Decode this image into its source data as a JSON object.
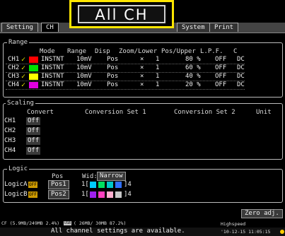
{
  "tabs": [
    "Setting",
    "CH",
    "System",
    "Print"
  ],
  "title": "All CH",
  "range": {
    "legend": "Range",
    "headers": [
      "Mode",
      "Range",
      "Disp",
      "Zoom/Lower",
      "Pos/Upper",
      "L.P.F.",
      "C"
    ],
    "rows": [
      {
        "ch": "CH1",
        "color": "#ff0000",
        "mode": "INSTNT",
        "range": "10mV",
        "disp": "Pos",
        "x": "×",
        "zoom": "1",
        "pos": "80 %",
        "lpf": "OFF",
        "c": "DC"
      },
      {
        "ch": "CH2",
        "color": "#00e000",
        "mode": "INSTNT",
        "range": "10mV",
        "disp": "Pos",
        "x": "×",
        "zoom": "1",
        "pos": "60 %",
        "lpf": "OFF",
        "c": "DC"
      },
      {
        "ch": "CH3",
        "color": "#ffff00",
        "mode": "INSTNT",
        "range": "10mV",
        "disp": "Pos",
        "x": "×",
        "zoom": "1",
        "pos": "40 %",
        "lpf": "OFF",
        "c": "DC"
      },
      {
        "ch": "CH4",
        "color": "#e000e0",
        "mode": "INSTNT",
        "range": "10mV",
        "disp": "Pos",
        "x": "×",
        "zoom": "1",
        "pos": "20 %",
        "lpf": "OFF",
        "c": "DC"
      }
    ]
  },
  "scaling": {
    "legend": "Scaling",
    "headers": [
      "Convert",
      "Conversion Set 1",
      "Conversion Set 2",
      "Unit"
    ],
    "rows": [
      {
        "ch": "CH1",
        "value": "Off"
      },
      {
        "ch": "CH2",
        "value": "Off"
      },
      {
        "ch": "CH3",
        "value": "Off"
      },
      {
        "ch": "CH4",
        "value": "Off"
      }
    ]
  },
  "logic": {
    "legend": "Logic",
    "pos_header": "Pos",
    "wid_label": "Wid:",
    "wid_value": "Narrow",
    "rows": [
      {
        "name": "LogicA",
        "tag": "OFF",
        "pos": "Pos1",
        "start": "1[",
        "end": "]4",
        "colors": [
          "#00ccff",
          "#00e060",
          "#00c8c8",
          "#3070ff"
        ]
      },
      {
        "name": "LogicB",
        "tag": "OFF",
        "pos": "Pos2",
        "start": "1[",
        "end": "]4",
        "colors": [
          "#a020f0",
          "#ff40c0",
          "#ffb0d0",
          "#c8c8c8"
        ]
      }
    ]
  },
  "zero_adj": "Zero adj.",
  "status": {
    "left": "CF (5.9MB/249MB 2.4%)",
    "usb_prefix": "USB",
    "mid": "( 26MB/ 30MB 87.2%)",
    "speed": "Highspeed",
    "time": "'10-12-15 11:05:15"
  },
  "message": "All channel settings are available."
}
